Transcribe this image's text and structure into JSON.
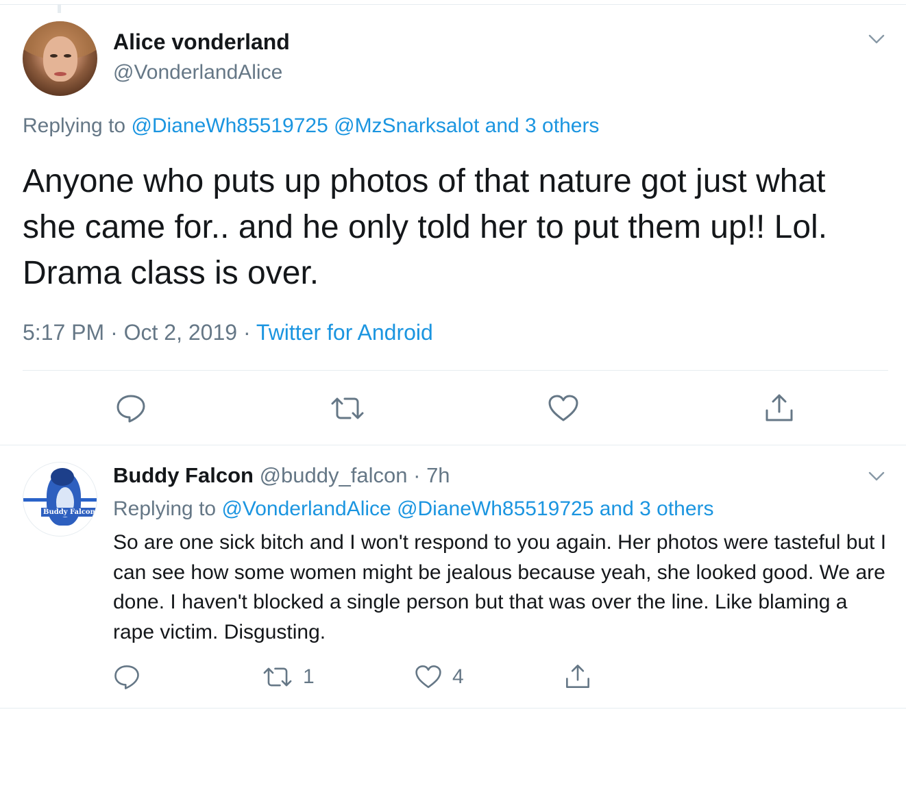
{
  "main_tweet": {
    "display_name": "Alice vonderland",
    "handle": "@VonderlandAlice",
    "replying_prefix": "Replying to",
    "replying_mention_1": "@DianeWh85519725",
    "replying_mention_2": "@MzSnarksalot",
    "replying_others": "and 3 others",
    "text": "Anyone who puts up photos of that nature got just what she came for.. and he only told her to put them up!! Lol. Drama class is over.",
    "time": "5:17 PM",
    "date": "Oct 2, 2019",
    "separator": "·",
    "source": "Twitter for Android",
    "icons": {
      "reply": "reply-icon",
      "retweet": "retweet-icon",
      "like": "like-icon",
      "share": "share-icon",
      "menu": "chevron-down-icon"
    }
  },
  "reply_tweet": {
    "display_name": "Buddy Falcon",
    "handle": "@buddy_falcon",
    "separator": "·",
    "age": "7h",
    "avatar_label": "Buddy Falcon",
    "replying_prefix": "Replying to",
    "replying_mention_1": "@VonderlandAlice",
    "replying_mention_2": "@DianeWh85519725",
    "replying_others": "and 3 others",
    "text": "So are one sick bitch and I won't respond to you again. Her photos were tasteful but I can see how some women might be jealous because yeah, she looked good.  We are done. I haven't blocked a single person but that was over the line. Like blaming a rape victim.  Disgusting.",
    "retweet_count": "1",
    "like_count": "4"
  },
  "colors": {
    "link": "#1b95e0",
    "secondary_text": "#657786",
    "primary_text": "#14171a",
    "divider": "#e6ecf0"
  }
}
